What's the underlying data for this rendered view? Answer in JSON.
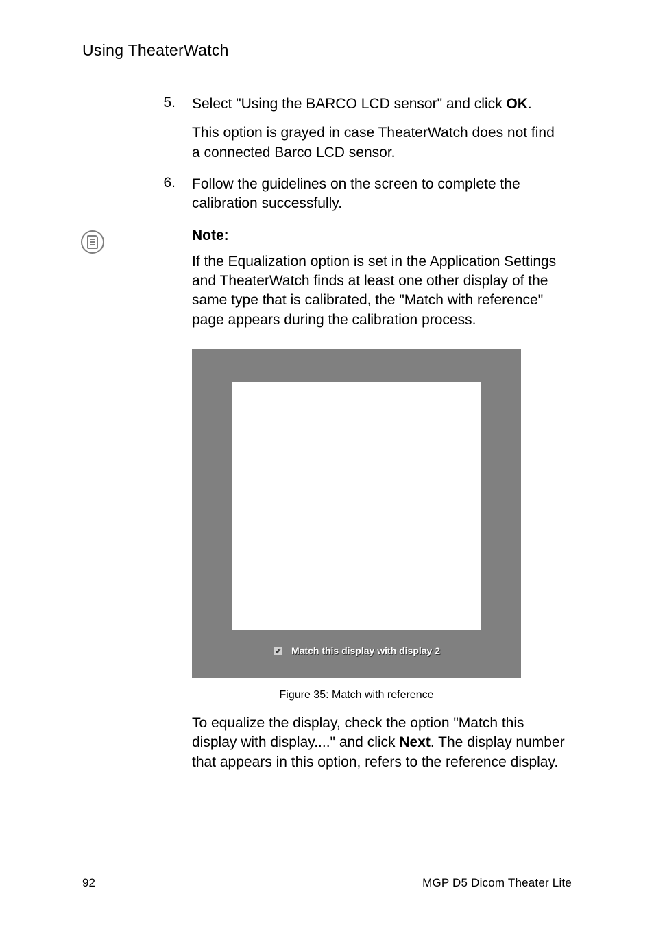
{
  "header": {
    "running_head": "Using TheaterWatch"
  },
  "steps": [
    {
      "num": "5.",
      "text_pre": "Select \"Using the BARCO LCD sensor\" and click ",
      "text_bold": "OK",
      "text_post": ".",
      "sub": "This option is grayed in case TheaterWatch does not find a connected Barco LCD sensor."
    },
    {
      "num": "6.",
      "text_pre": "Follow the guidelines on the screen to complete the calibration successfully.",
      "text_bold": "",
      "text_post": "",
      "sub": ""
    }
  ],
  "note": {
    "label": "Note:",
    "text": "If the Equalization option is set in the Application Settings and TheaterWatch finds at least one other display of the same type that is calibrated, the \"Match with reference\" page appears during the calibration process."
  },
  "figure": {
    "checkbox_label": "Match this display with display 2",
    "caption": "Figure 35: Match with reference"
  },
  "equalize": {
    "pre": "To equalize the display, check the option \"Match this display with display....\" and click ",
    "bold": "Next",
    "post": ". The display number that appears in this option, refers to the reference display."
  },
  "footer": {
    "page": "92",
    "title": "MGP D5 Dicom Theater Lite"
  }
}
